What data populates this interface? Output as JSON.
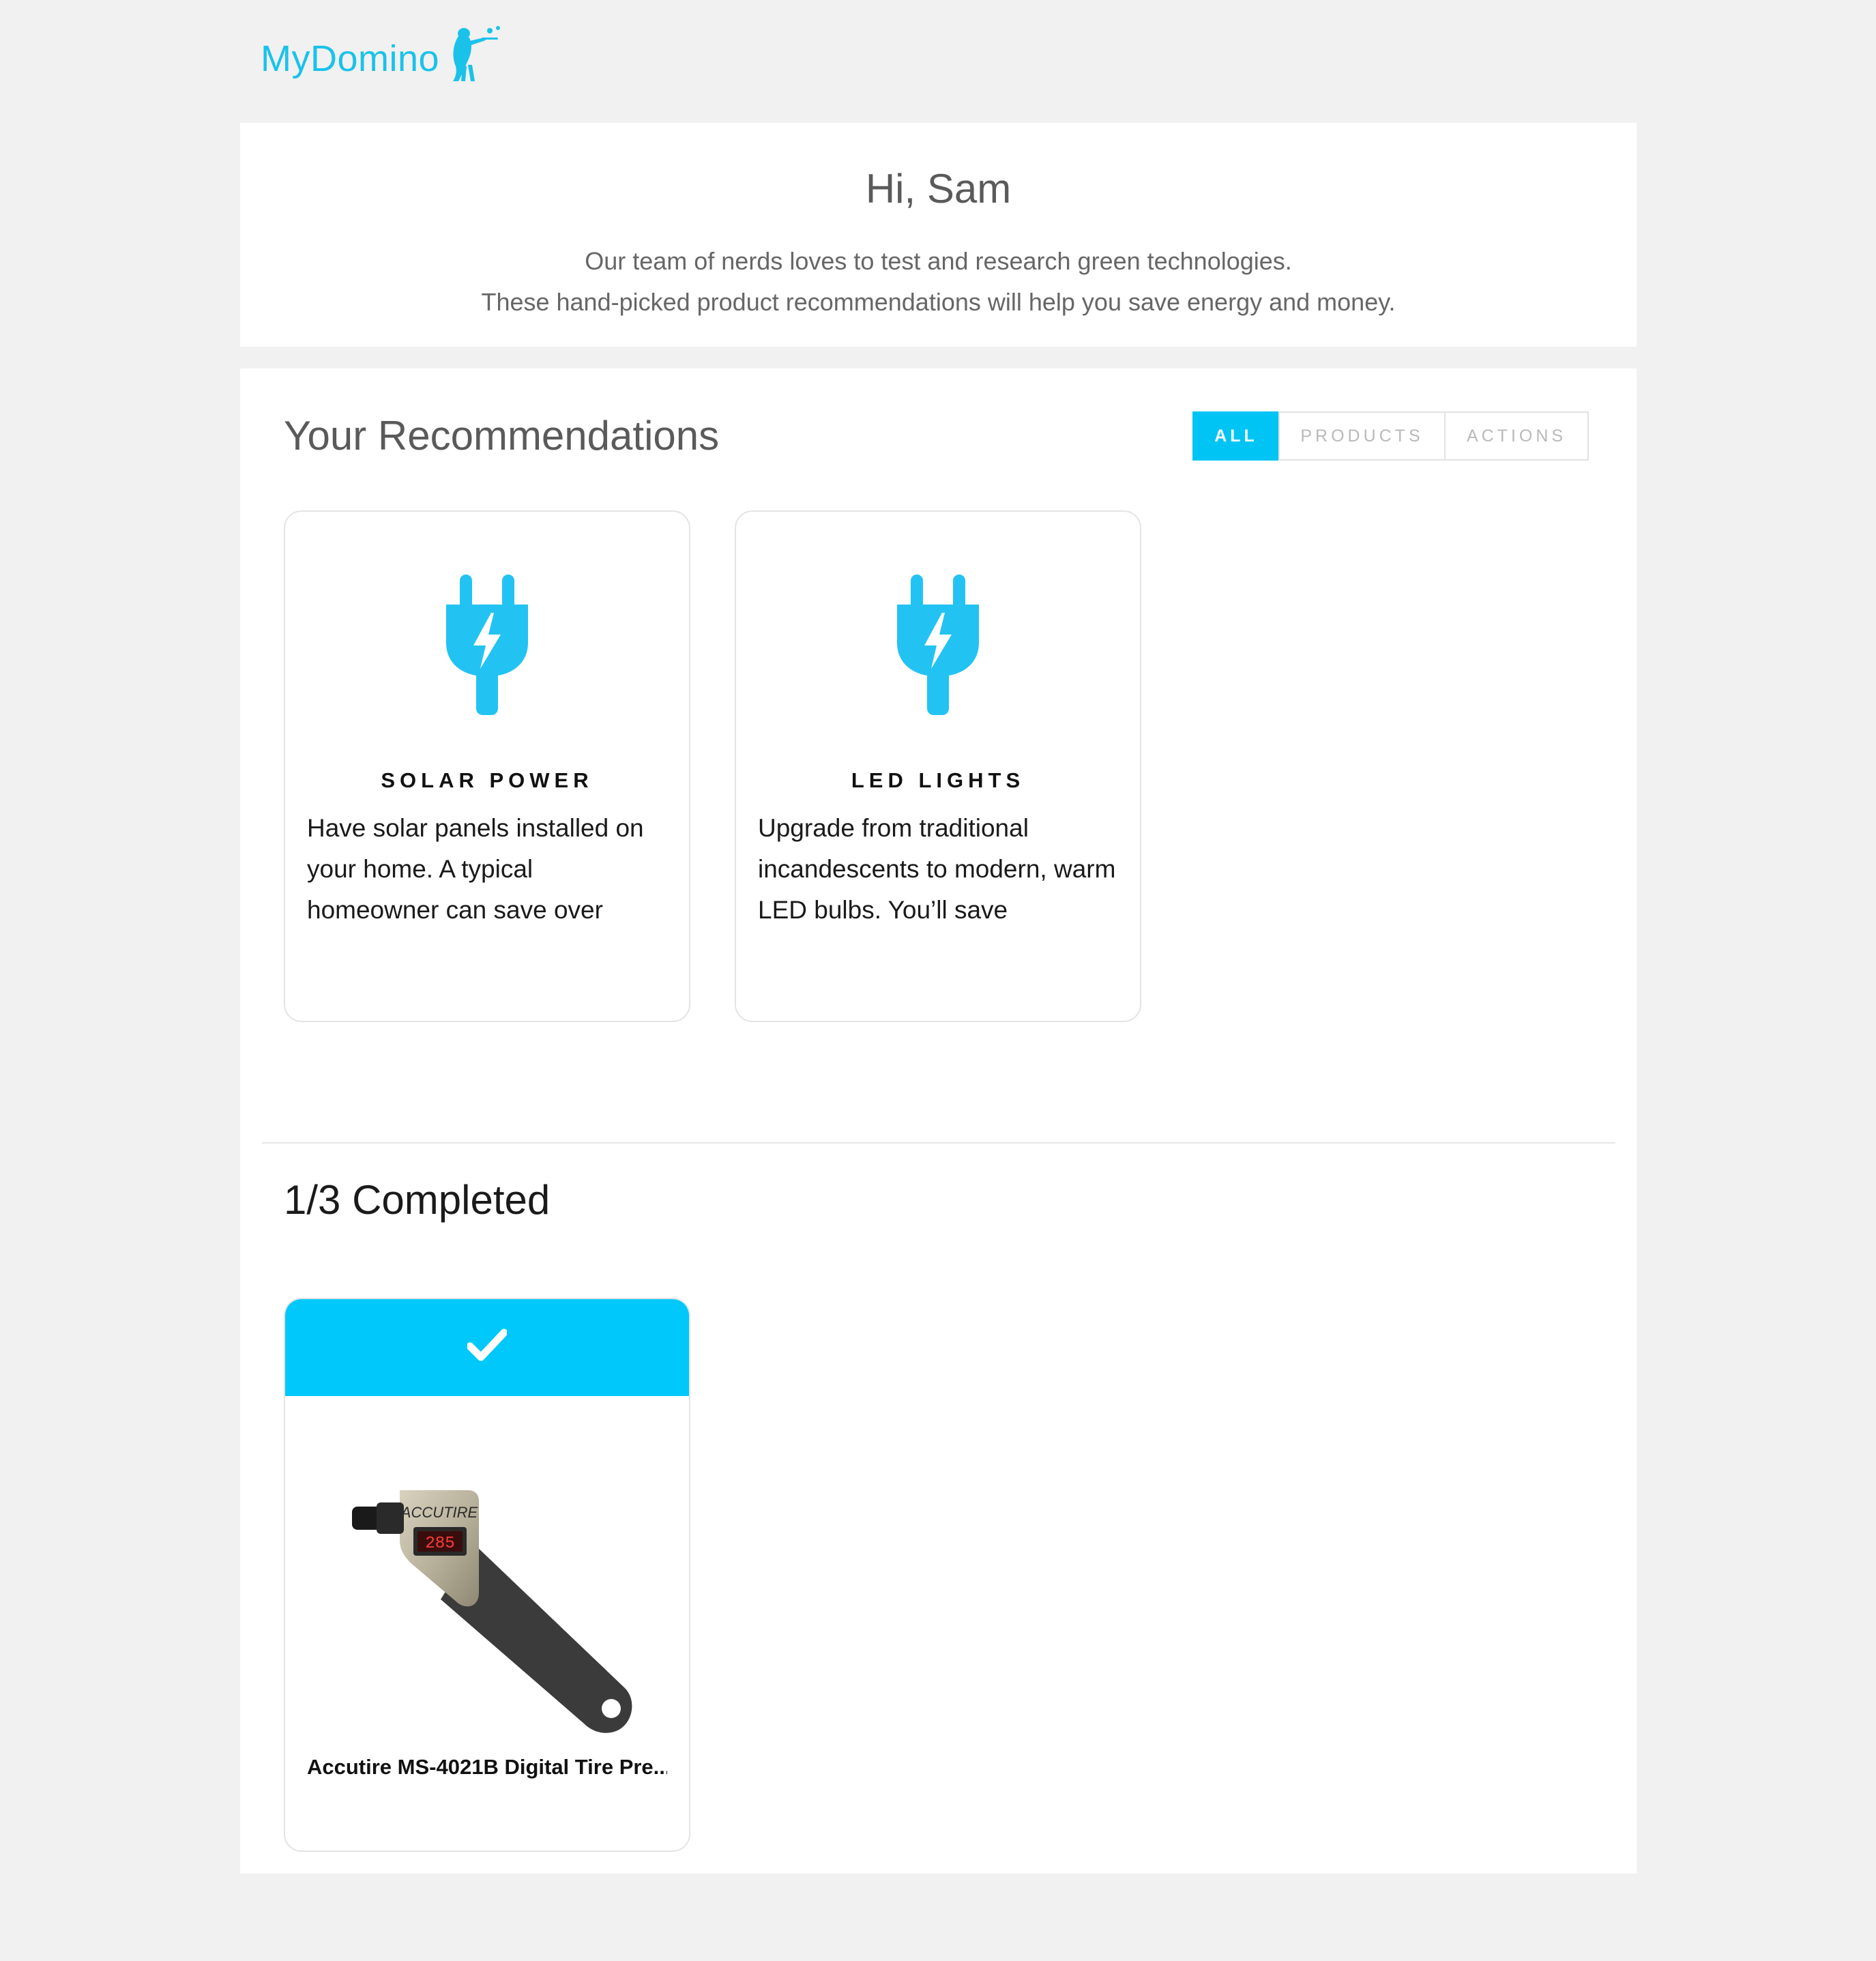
{
  "brand": {
    "name": "MyDomino",
    "color": "#1ac2ea"
  },
  "greeting": {
    "title": "Hi, Sam",
    "line1": "Our team of nerds loves to test and research green technologies.",
    "line2": "These hand-picked product recommendations will help you save energy and money."
  },
  "recommendations": {
    "title": "Your Recommendations",
    "filters": [
      {
        "label": "ALL",
        "active": true
      },
      {
        "label": "PRODUCTS",
        "active": false
      },
      {
        "label": "ACTIONS",
        "active": false
      }
    ],
    "cards": [
      {
        "icon": "plug-icon",
        "title": "SOLAR POWER",
        "text": "Have solar panels installed on your home. A typical homeowner can save over"
      },
      {
        "icon": "plug-icon",
        "title": "LED LIGHTS",
        "text": "Upgrade from traditional incandescents to modern, warm LED bulbs. You’ll save"
      }
    ]
  },
  "completed": {
    "title": "1/3 Completed",
    "items": [
      {
        "icon": "checkmark-icon",
        "product_name": "Accutire MS-4021B Digital Tire Pre...",
        "gauge_brand": "ACCUTIRE",
        "gauge_reading": "285"
      }
    ]
  },
  "colors": {
    "accent": "#00c4f4",
    "background": "#f1f1f1",
    "card": "#ffffff"
  }
}
